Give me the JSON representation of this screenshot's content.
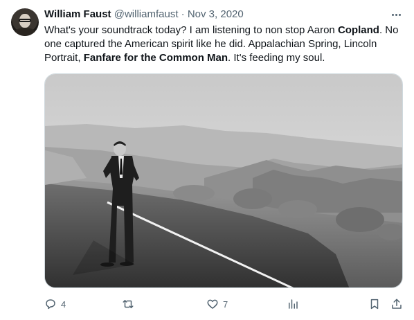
{
  "tweet": {
    "author_name": "William Faust",
    "handle": "@williamfaust",
    "separator": "·",
    "date": "Nov 3, 2020",
    "text_parts": [
      {
        "text": "What's your soundtrack today? I am listening to non stop Aaron ",
        "bold": false
      },
      {
        "text": "Copland",
        "bold": true
      },
      {
        "text": ". No one captured the American spirit like he did. Appalachian Spring, Lincoln Portrait, ",
        "bold": false
      },
      {
        "text": "Fanfare for the Common Man",
        "bold": true
      },
      {
        "text": ". It's feeding my soul.",
        "bold": false
      }
    ],
    "media_alt": "Black and white photo of a man in a suit walking along a desert mountain road"
  },
  "actions": {
    "reply_icon": "reply-icon",
    "reply_count": "4",
    "retweet_icon": "retweet-icon",
    "retweet_count": "",
    "like_icon": "heart-icon",
    "like_count": "7",
    "views_icon": "views-icon",
    "views_count": "",
    "bookmark_icon": "bookmark-icon",
    "share_icon": "share-icon"
  },
  "colors": {
    "text_primary": "#0f1419",
    "text_secondary": "#536471",
    "border": "#cfd9de",
    "background": "#ffffff"
  }
}
